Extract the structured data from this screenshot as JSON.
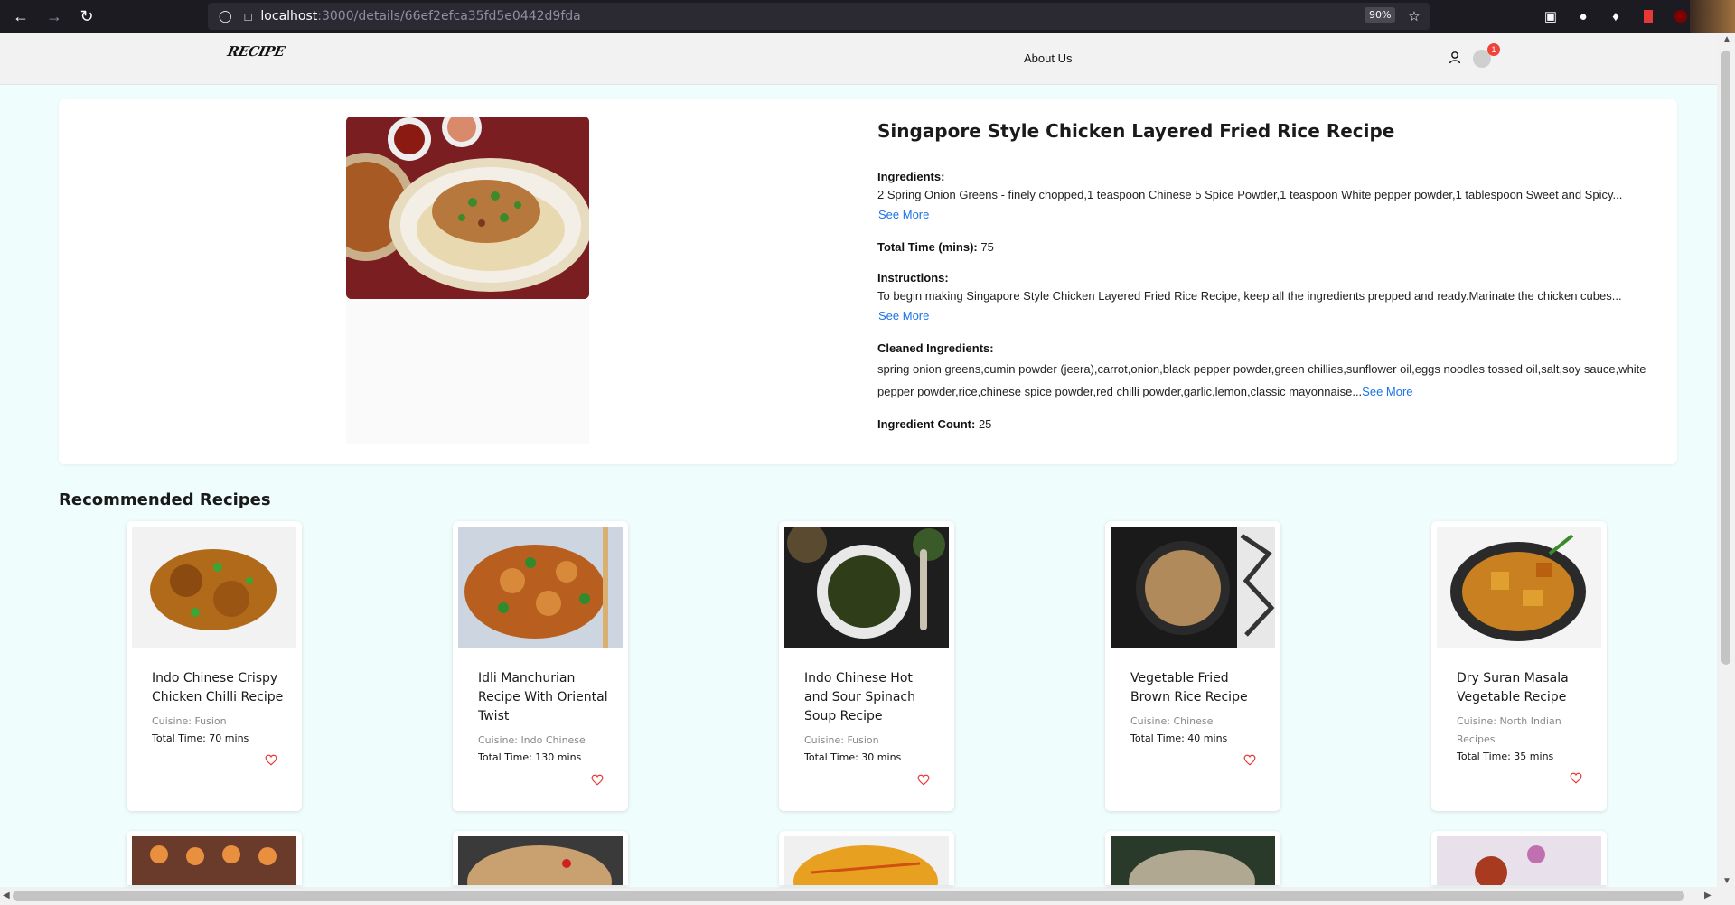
{
  "browser": {
    "url_host": "localhost",
    "url_path": ":3000/details/66ef2efca35fd5e0442d9fda",
    "zoom": "90%"
  },
  "header": {
    "logo": "RECIPE",
    "about": "About Us",
    "cart_count": "1"
  },
  "recipe": {
    "title": "Singapore Style Chicken Layered Fried Rice Recipe",
    "ingredients_label": "Ingredients:",
    "ingredients_text": "2 Spring Onion Greens - finely chopped,1 teaspoon Chinese 5 Spice Powder,1 teaspoon White pepper powder,1 tablespoon Sweet and Spicy...",
    "see_more": "See More",
    "total_time_label": "Total Time (mins):",
    "total_time_value": "75",
    "instructions_label": "Instructions:",
    "instructions_text": "To begin making Singapore Style Chicken Layered Fried Rice Recipe, keep all the ingredients prepped and ready.Marinate the chicken cubes...",
    "cleaned_label": "Cleaned Ingredients:",
    "cleaned_line1": "spring onion greens,cumin powder (jeera),carrot,onion,black pepper powder,green chillies,sunflower oil,eggs noodles tossed oil,salt,soy sauce,white",
    "cleaned_line2": "pepper powder,rice,chinese spice powder,red chilli powder,garlic,lemon,classic mayonnaise...",
    "count_label": "Ingredient Count:",
    "count_value": "25"
  },
  "recommended": {
    "heading": "Recommended Recipes",
    "cards": [
      {
        "title": "Indo Chinese Crispy Chicken Chilli Recipe",
        "cuisine": "Cuisine: Fusion",
        "time": "Total Time: 70 mins"
      },
      {
        "title": "Idli Manchurian Recipe With Oriental Twist",
        "cuisine": "Cuisine: Indo Chinese",
        "time": "Total Time: 130 mins"
      },
      {
        "title": "Indo Chinese Hot and Sour Spinach Soup Recipe",
        "cuisine": "Cuisine: Fusion",
        "time": "Total Time: 30 mins"
      },
      {
        "title": "Vegetable Fried Brown Rice Recipe",
        "cuisine": "Cuisine: Chinese",
        "time": "Total Time: 40 mins"
      },
      {
        "title": "Dry Suran Masala Vegetable Recipe",
        "cuisine": "Cuisine: North Indian Recipes",
        "time": "Total Time: 35 mins"
      }
    ]
  },
  "colors": {
    "page_bg": "#f0fdfd",
    "link": "#1a73e8",
    "heart": "#e53935",
    "badge": "#f0443a"
  }
}
